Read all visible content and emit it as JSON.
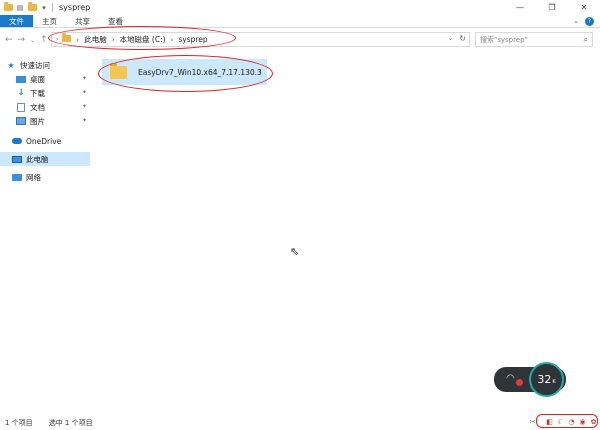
{
  "window": {
    "title": "sysprep",
    "controls": {
      "minimize": "—",
      "maximize": "❐",
      "close": "✕"
    }
  },
  "ribbon": {
    "tabs": [
      "文件",
      "主页",
      "共享",
      "查看"
    ],
    "expand_icon": "chevron-down-icon",
    "help_icon": "help-icon"
  },
  "address": {
    "breadcrumbs": [
      "此电脑",
      "本地磁盘 (C:)",
      "sysprep"
    ],
    "search_placeholder": "搜索\"sysprep\""
  },
  "navpane": {
    "quick_access": "快速访问",
    "items": [
      "桌面",
      "下载",
      "文档",
      "图片"
    ],
    "onedrive": "OneDrive",
    "this_pc": "此电脑",
    "network": "网络"
  },
  "content": {
    "files": [
      {
        "name": "EasyDrv7_Win10.x64_7.17.130.3",
        "type": "folder"
      }
    ]
  },
  "statusbar": {
    "count": "1 个项目",
    "selected": "选中 1 个项目"
  },
  "netwidget": {
    "speed_value": "32",
    "speed_unit": "K"
  },
  "colors": {
    "accent": "#1979ca",
    "selection": "#cce8ff",
    "annotation": "#d4252b",
    "folder": "#f2c656"
  }
}
